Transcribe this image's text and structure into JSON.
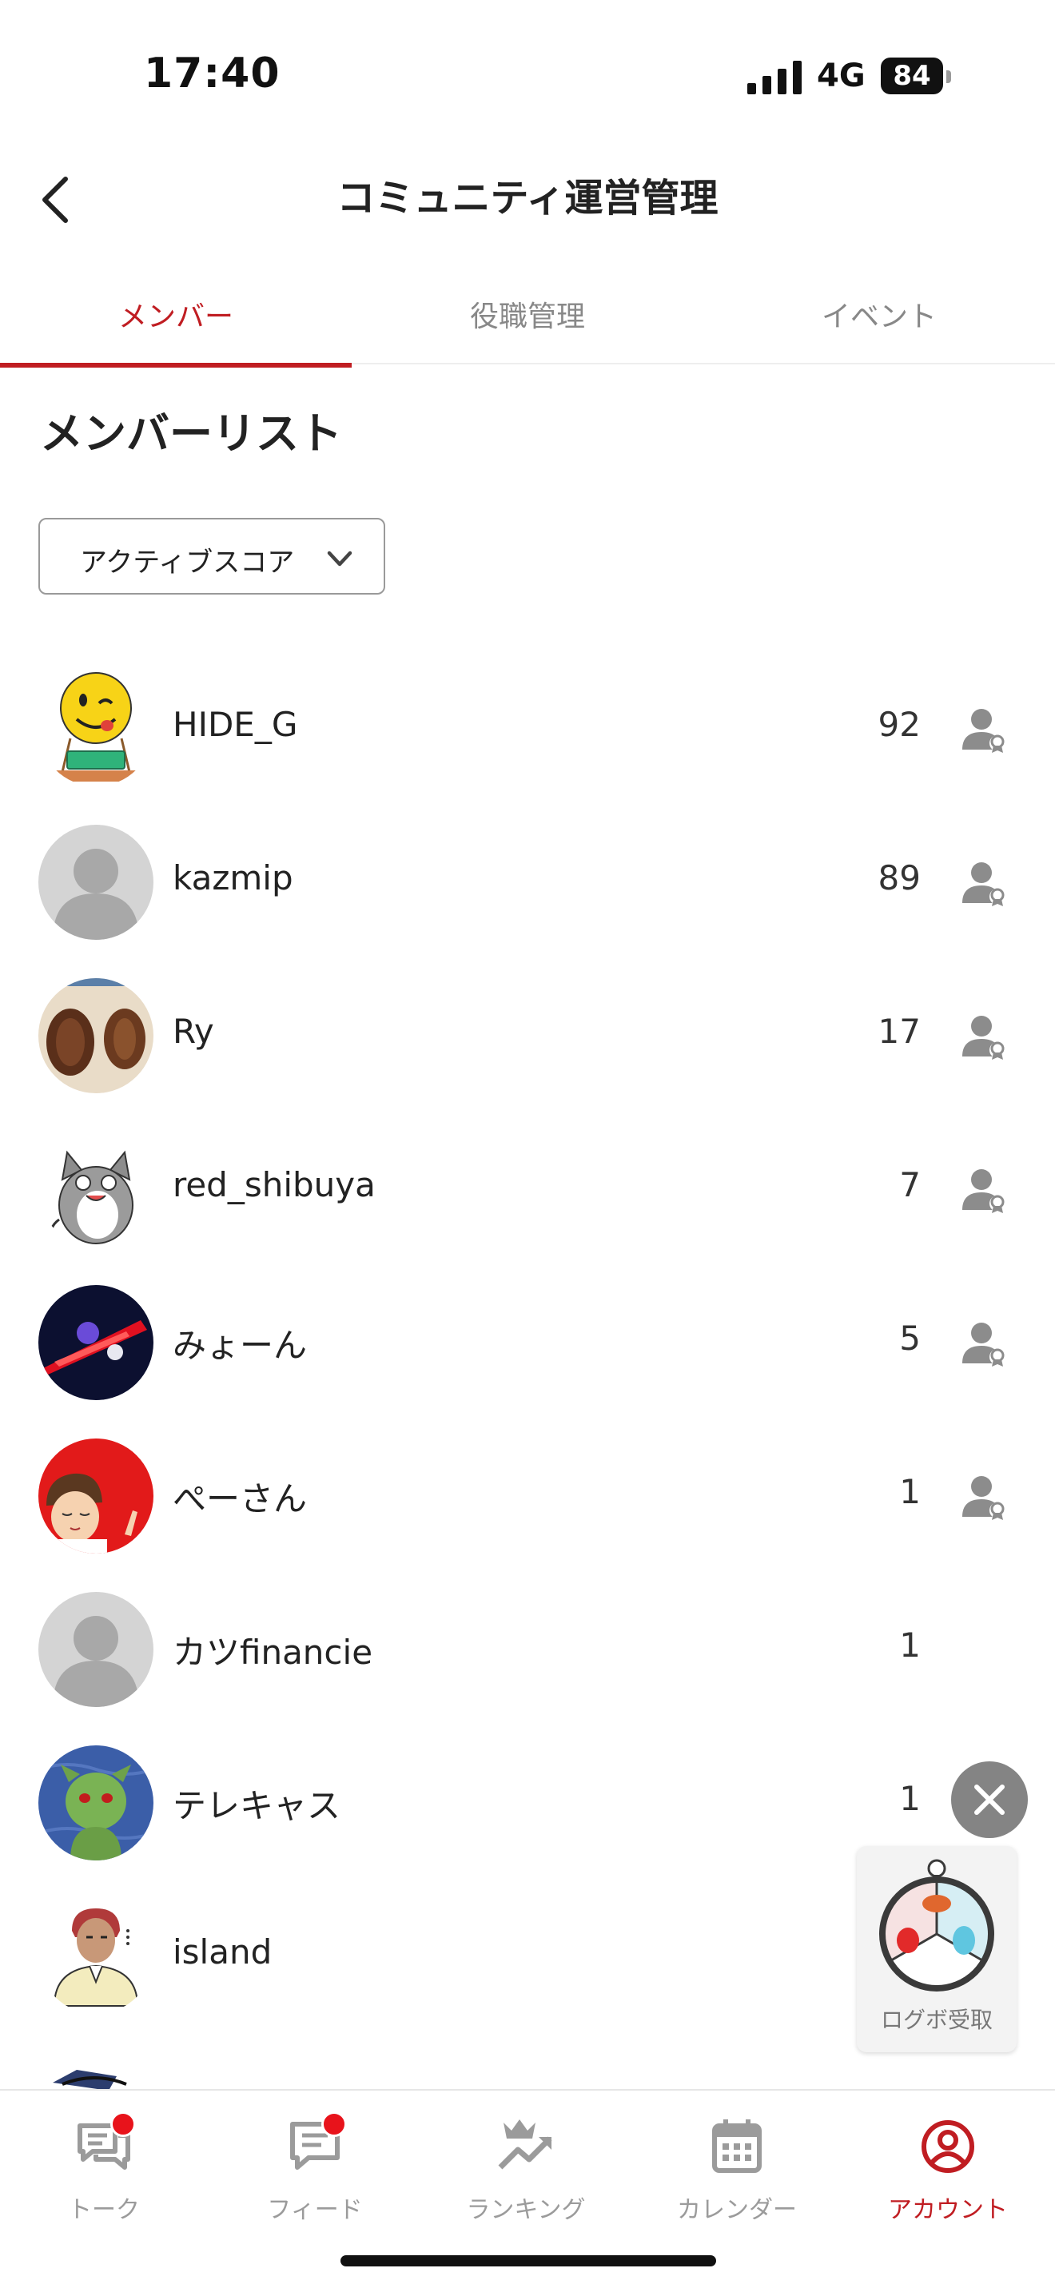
{
  "status_bar": {
    "time": "17:40",
    "network": "4G",
    "battery": "84",
    "icons": [
      "signal-icon",
      "battery-icon"
    ]
  },
  "header": {
    "title": "コミュニティ運営管理",
    "back_icon": "chevron-left-icon"
  },
  "tabs": [
    {
      "label": "メンバー",
      "active": true
    },
    {
      "label": "役職管理",
      "active": false
    },
    {
      "label": "イベント",
      "active": false
    }
  ],
  "member_list": {
    "title": "メンバーリスト",
    "sort": {
      "selected": "アクティブスコア",
      "icon": "chevron-down-icon"
    },
    "members": [
      {
        "name": "HIDE_G",
        "score": "92",
        "role_icon": true,
        "avatar": "smiley-balloon"
      },
      {
        "name": "kazmip",
        "score": "89",
        "role_icon": true,
        "avatar": "default"
      },
      {
        "name": "Ry",
        "score": "17",
        "role_icon": true,
        "avatar": "photo-brown"
      },
      {
        "name": "red_shibuya",
        "score": "7",
        "role_icon": true,
        "avatar": "cat-sticker"
      },
      {
        "name": "みょーん",
        "score": "5",
        "role_icon": true,
        "avatar": "dark-red-streak"
      },
      {
        "name": "ぺーさん",
        "score": "1",
        "role_icon": true,
        "avatar": "red-cartoon"
      },
      {
        "name": "カツfinancie",
        "score": "1",
        "role_icon": false,
        "avatar": "default"
      },
      {
        "name": "テレキャス",
        "score": "1",
        "role_icon": true,
        "avatar": "green-creature"
      },
      {
        "name": "island",
        "score": "",
        "role_icon": false,
        "avatar": "island-person"
      }
    ]
  },
  "floating": {
    "close_icon": "close-icon",
    "bonus_label": "ログボ受取"
  },
  "bottom_nav": [
    {
      "label": "トーク",
      "icon": "chat-icon",
      "badge": true,
      "active": false
    },
    {
      "label": "フィード",
      "icon": "feed-icon",
      "badge": true,
      "active": false
    },
    {
      "label": "ランキング",
      "icon": "ranking-icon",
      "badge": false,
      "active": false
    },
    {
      "label": "カレンダー",
      "icon": "calendar-icon",
      "badge": false,
      "active": false
    },
    {
      "label": "アカウント",
      "icon": "account-icon",
      "badge": false,
      "active": true
    }
  ],
  "colors": {
    "accent": "#c01d22",
    "badge": "#e8131b",
    "inactive": "#9b9b9b"
  }
}
